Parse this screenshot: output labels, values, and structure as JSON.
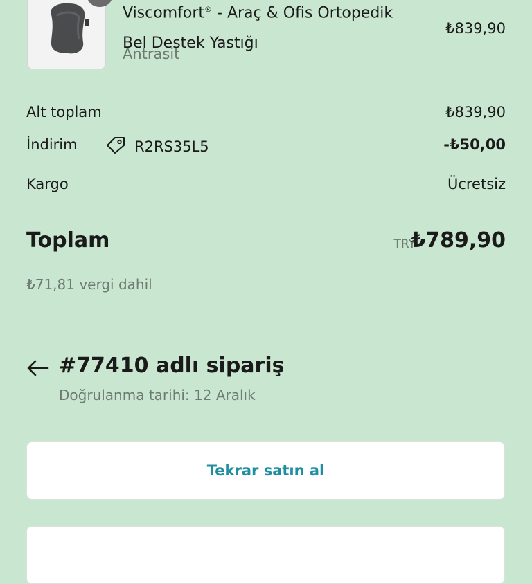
{
  "product": {
    "title_brand": "Viscomfort",
    "title_mark": "®",
    "title_rest": " - Araç & Ofis Ortopedik Bel Destek Yastığı",
    "variant": "Antrasit",
    "price": "₺839,90",
    "icon": "lumbar-pillow-image"
  },
  "summary": {
    "subtotal_label": "Alt toplam",
    "subtotal_value": "₺839,90",
    "discount_label": "İndirim",
    "discount_code": "R2RS35L5",
    "discount_icon": "tag-icon",
    "discount_value": "-₺50,00",
    "shipping_label": "Kargo",
    "shipping_value": "Ücretsiz",
    "total_label": "Toplam",
    "total_currency": "TRY",
    "total_value": "₺789,90",
    "tax_note": "₺71,81 vergi dahil"
  },
  "order": {
    "title": "#77410 adlı sipariş",
    "confirmed": "Doğrulanma tarihi: 12 Aralık",
    "back_icon": "arrow-left-icon"
  },
  "actions": {
    "buy_again": "Tekrar satın al"
  },
  "colors": {
    "background": "#c8e6d0",
    "accent": "#1f8fa0",
    "muted": "#6f7a72"
  }
}
